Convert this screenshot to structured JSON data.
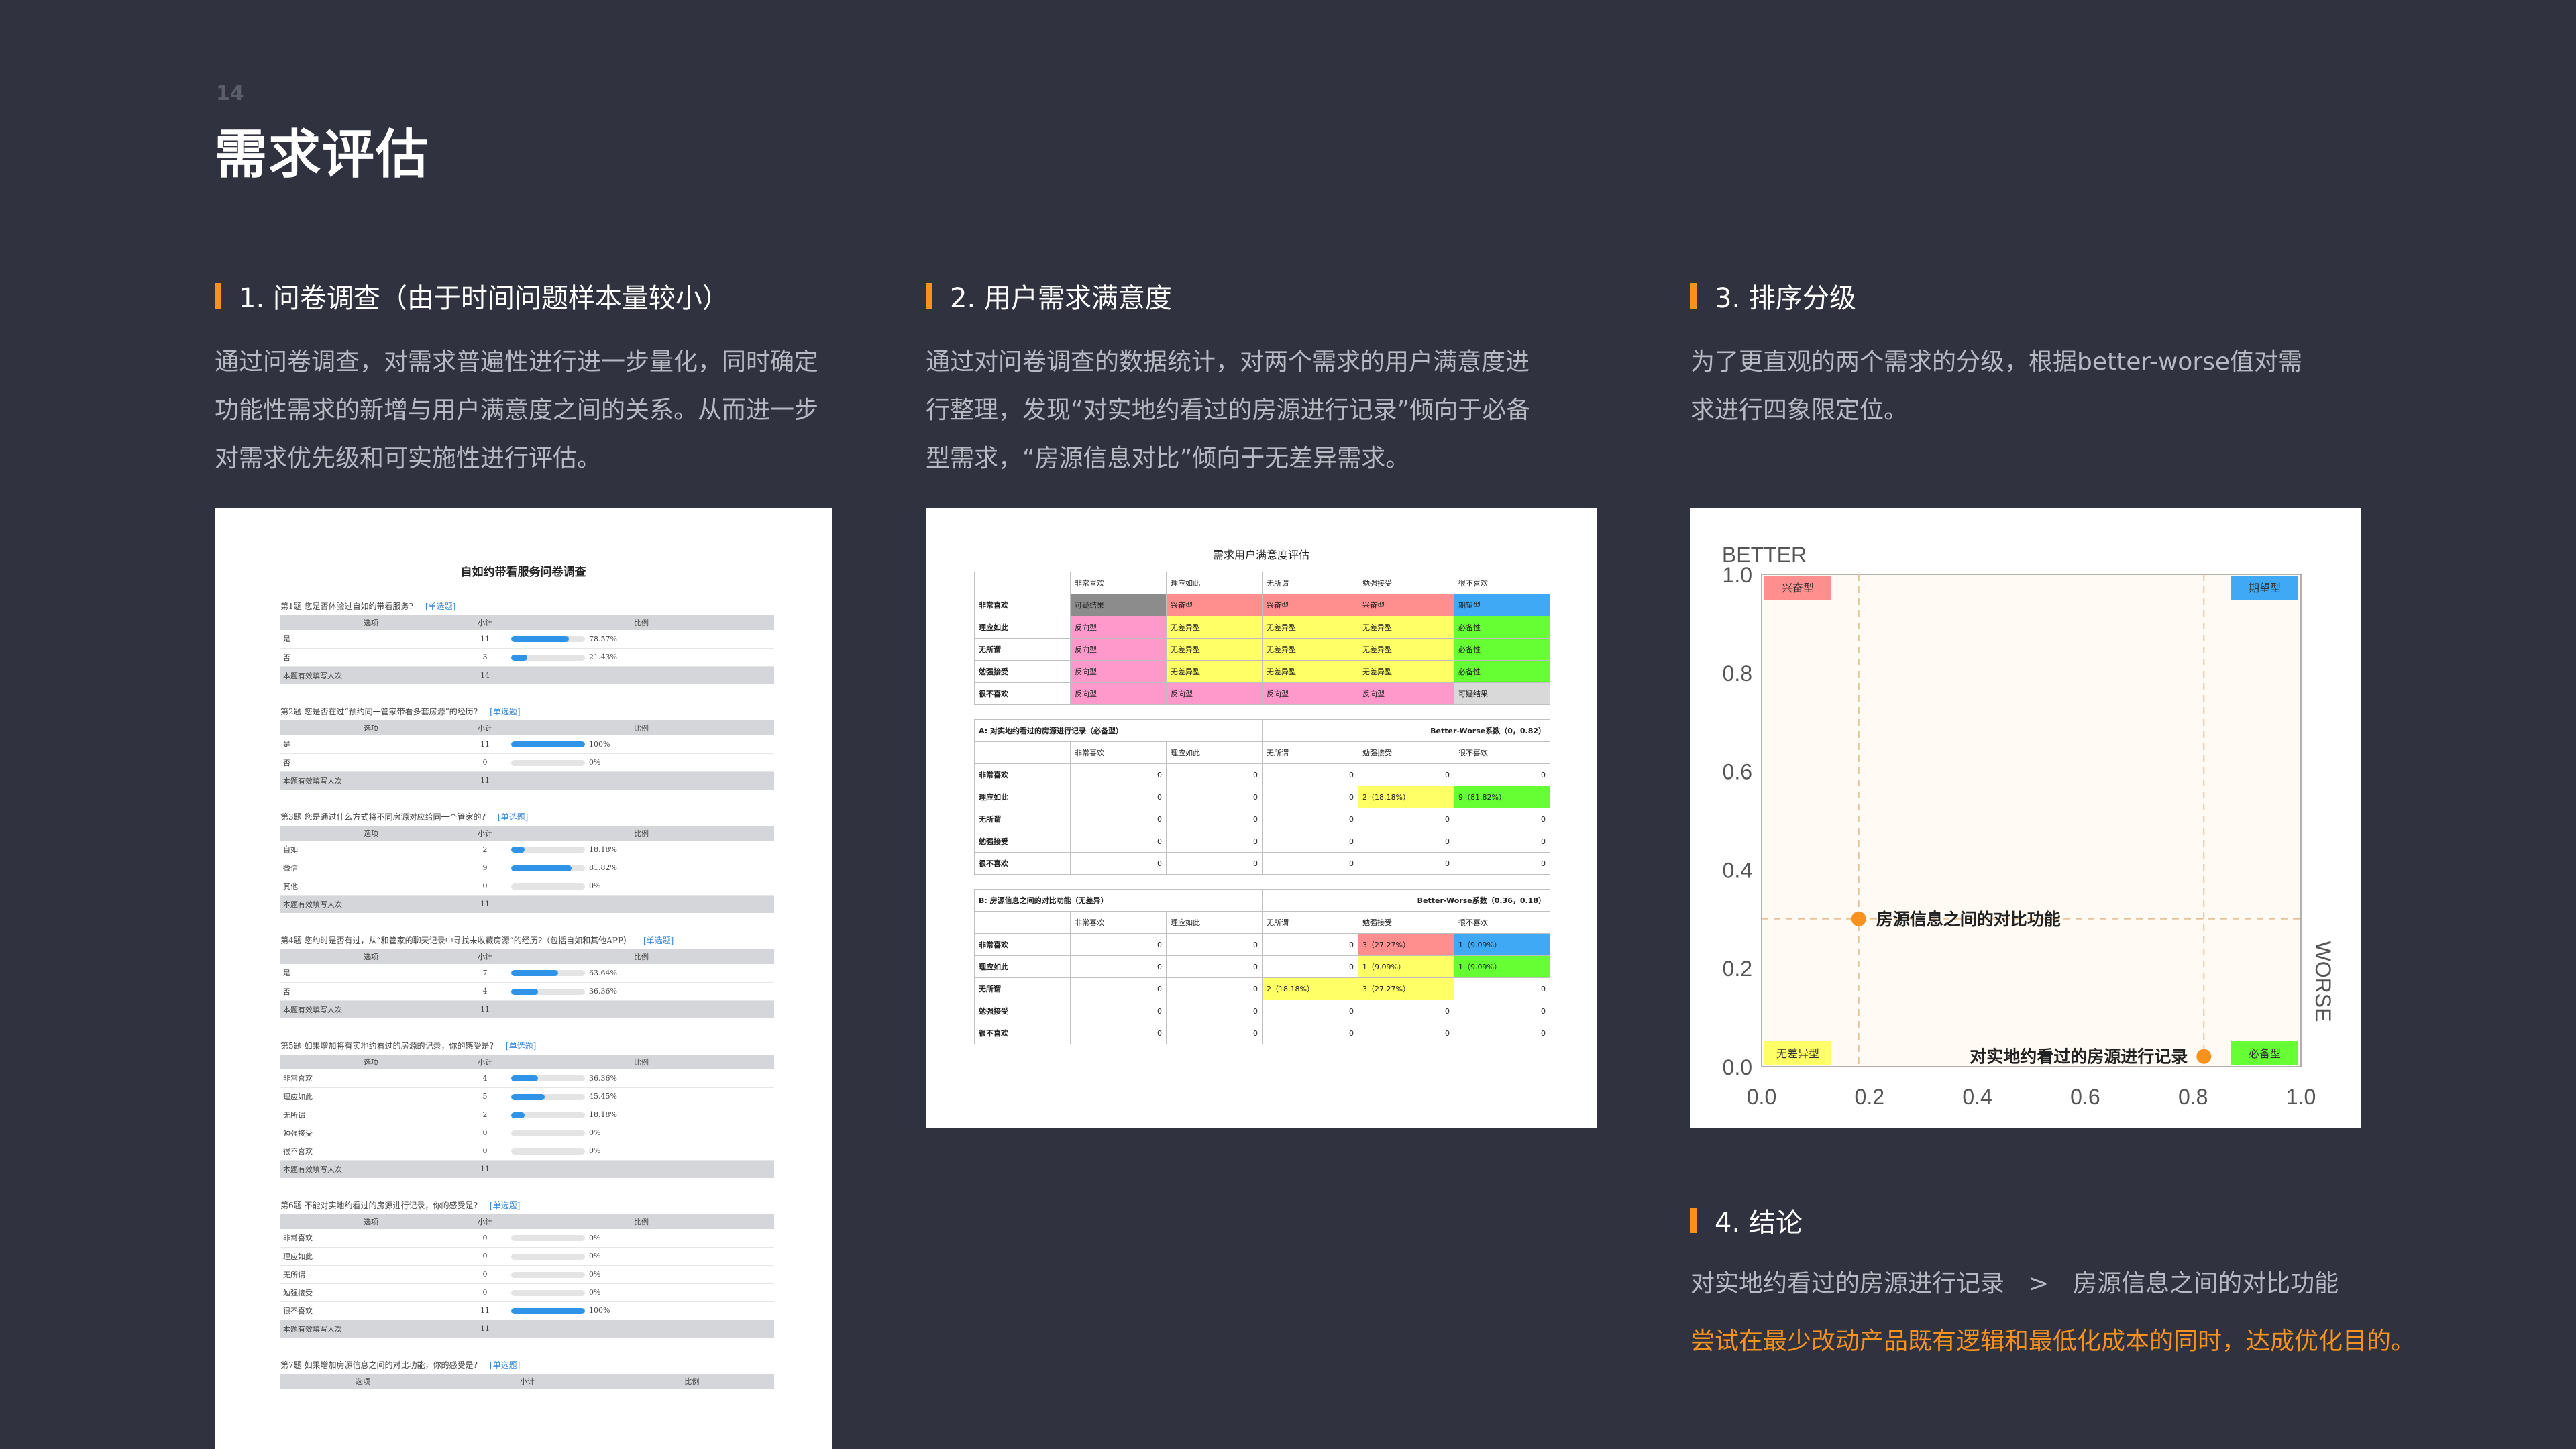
{
  "page": {
    "number": "14",
    "title": "需求评估"
  },
  "sections": [
    {
      "heading": "1. 问卷调查（由于时间问题样本量较小）",
      "lines": [
        "通过问卷调查，对需求普遍性进行进一步量化，同时确定",
        "功能性需求的新增与用户满意度之间的关系。从而进一步",
        "对需求优先级和可实施性进行评估。"
      ]
    },
    {
      "heading": "2. 用户需求满意度",
      "lines": [
        "通过对问卷调查的数据统计，对两个需求的用户满意度进",
        "行整理，发现“对实地约看过的房源进行记录”倾向于必备",
        "型需求，“房源信息对比”倾向于无差异需求。"
      ]
    },
    {
      "heading": "3. 排序分级",
      "lines": [
        "为了更直观的两个需求的分级，根据better-worse值对需",
        "求进行四象限定位。"
      ]
    },
    {
      "heading": "4. 结论",
      "lines": [
        "对实地约看过的房源进行记录　>　房源信息之间的对比功能",
        "尝试在最少改动产品既有逻辑和最低化成本的同时，达成优化目的。"
      ]
    }
  ],
  "survey": {
    "title": "自如约带看服务问卷调查",
    "header": [
      "选项",
      "小计",
      "比例"
    ],
    "total_label": "本题有效填写人次",
    "questions": [
      {
        "title": "第1题  您是否体验过自如约带看服务?",
        "tag": "[单选题]",
        "rows": [
          {
            "o": "是",
            "n": "11",
            "p": "78.57%",
            "f": 0.7857
          },
          {
            "o": "否",
            "n": "3",
            "p": "21.43%",
            "f": 0.2143
          }
        ],
        "total": "14"
      },
      {
        "title": "第2题  您是否在过“预约同一管家带看多套房源”的经历?",
        "tag": "[单选题]",
        "rows": [
          {
            "o": "是",
            "n": "11",
            "p": "100%",
            "f": 1
          },
          {
            "o": "否",
            "n": "0",
            "p": "0%",
            "f": 0
          }
        ],
        "total": "11"
      },
      {
        "title": "第3题  您是通过什么方式将不同房源对应给同一个管家的?",
        "tag": "[单选题]",
        "rows": [
          {
            "o": "自如",
            "n": "2",
            "p": "18.18%",
            "f": 0.1818
          },
          {
            "o": "微信",
            "n": "9",
            "p": "81.82%",
            "f": 0.8182
          },
          {
            "o": "其他",
            "n": "0",
            "p": "0%",
            "f": 0
          }
        ],
        "total": "11"
      },
      {
        "title": "第4题  您约时是否有过，从“和管家的聊天记录中寻找未收藏房源”的经历?（包括自如和其他APP）",
        "tag": "[单选题]",
        "rows": [
          {
            "o": "是",
            "n": "7",
            "p": "63.64%",
            "f": 0.6364
          },
          {
            "o": "否",
            "n": "4",
            "p": "36.36%",
            "f": 0.3636
          }
        ],
        "total": "11"
      },
      {
        "title": "第5题  如果增加将有实地约看过的房源的记录，你的感受是?",
        "tag": "[单选题]",
        "rows": [
          {
            "o": "非常喜欢",
            "n": "4",
            "p": "36.36%",
            "f": 0.3636
          },
          {
            "o": "理应如此",
            "n": "5",
            "p": "45.45%",
            "f": 0.4545
          },
          {
            "o": "无所谓",
            "n": "2",
            "p": "18.18%",
            "f": 0.1818
          },
          {
            "o": "勉强接受",
            "n": "0",
            "p": "0%",
            "f": 0
          },
          {
            "o": "很不喜欢",
            "n": "0",
            "p": "0%",
            "f": 0
          }
        ],
        "total": "11"
      },
      {
        "title": "第6题  不能对实地约看过的房源进行记录，你的感受是?",
        "tag": "[单选题]",
        "rows": [
          {
            "o": "非常喜欢",
            "n": "0",
            "p": "0%",
            "f": 0
          },
          {
            "o": "理应如此",
            "n": "0",
            "p": "0%",
            "f": 0
          },
          {
            "o": "无所谓",
            "n": "0",
            "p": "0%",
            "f": 0
          },
          {
            "o": "勉强接受",
            "n": "0",
            "p": "0%",
            "f": 0
          },
          {
            "o": "很不喜欢",
            "n": "11",
            "p": "100%",
            "f": 1
          }
        ],
        "total": "11"
      },
      {
        "title": "第7题  如果增加房源信息之间的对比功能，你的感受是?",
        "tag": "[单选题]",
        "rows": [],
        "total": ""
      }
    ]
  },
  "satisfaction": {
    "title": "需求用户满意度评估",
    "cols": [
      "非常喜欢",
      "理应如此",
      "无所谓",
      "勉强接受",
      "很不喜欢"
    ],
    "matrix_rows": [
      {
        "label": "非常喜欢",
        "cells": [
          {
            "t": "可疑结果",
            "c": "#8c8c8c"
          },
          {
            "t": "兴奋型",
            "c": "#ff8f8f"
          },
          {
            "t": "兴奋型",
            "c": "#ff8f8f"
          },
          {
            "t": "兴奋型",
            "c": "#ff8f8f"
          },
          {
            "t": "期望型",
            "c": "#3fa9f5"
          }
        ]
      },
      {
        "label": "理应如此",
        "cells": [
          {
            "t": "反向型",
            "c": "#ff99cc"
          },
          {
            "t": "无差异型",
            "c": "#ffff66"
          },
          {
            "t": "无差异型",
            "c": "#ffff66"
          },
          {
            "t": "无差异型",
            "c": "#ffff66"
          },
          {
            "t": "必备性",
            "c": "#66ff33"
          }
        ]
      },
      {
        "label": "无所谓",
        "cells": [
          {
            "t": "反向型",
            "c": "#ff99cc"
          },
          {
            "t": "无差异型",
            "c": "#ffff66"
          },
          {
            "t": "无差异型",
            "c": "#ffff66"
          },
          {
            "t": "无差异型",
            "c": "#ffff66"
          },
          {
            "t": "必备性",
            "c": "#66ff33"
          }
        ]
      },
      {
        "label": "勉强接受",
        "cells": [
          {
            "t": "反向型",
            "c": "#ff99cc"
          },
          {
            "t": "无差异型",
            "c": "#ffff66"
          },
          {
            "t": "无差异型",
            "c": "#ffff66"
          },
          {
            "t": "无差异型",
            "c": "#ffff66"
          },
          {
            "t": "必备性",
            "c": "#66ff33"
          }
        ]
      },
      {
        "label": "很不喜欢",
        "cells": [
          {
            "t": "反向型",
            "c": "#ff99cc"
          },
          {
            "t": "反向型",
            "c": "#ff99cc"
          },
          {
            "t": "反向型",
            "c": "#ff99cc"
          },
          {
            "t": "反向型",
            "c": "#ff99cc"
          },
          {
            "t": "可疑结果",
            "c": "#d9d9d9"
          }
        ]
      }
    ],
    "blocks": [
      {
        "name": "A: 对实地约看过的房源进行记录（必备型）",
        "coef": "Better-Worse系数（0，0.82）",
        "rows": [
          {
            "label": "非常喜欢",
            "cells": [
              {
                "t": "0"
              },
              {
                "t": "0"
              },
              {
                "t": "0"
              },
              {
                "t": "0"
              },
              {
                "t": "0"
              }
            ]
          },
          {
            "label": "理应如此",
            "cells": [
              {
                "t": "0"
              },
              {
                "t": "0"
              },
              {
                "t": "0"
              },
              {
                "t": "2（18.18%）",
                "c": "#ffff66",
                "l": 1
              },
              {
                "t": "9（81.82%）",
                "c": "#66ff33",
                "l": 1
              }
            ]
          },
          {
            "label": "无所谓",
            "cells": [
              {
                "t": "0"
              },
              {
                "t": "0"
              },
              {
                "t": "0"
              },
              {
                "t": "0"
              },
              {
                "t": "0"
              }
            ]
          },
          {
            "label": "勉强接受",
            "cells": [
              {
                "t": "0"
              },
              {
                "t": "0"
              },
              {
                "t": "0"
              },
              {
                "t": "0"
              },
              {
                "t": "0"
              }
            ]
          },
          {
            "label": "很不喜欢",
            "cells": [
              {
                "t": "0"
              },
              {
                "t": "0"
              },
              {
                "t": "0"
              },
              {
                "t": "0"
              },
              {
                "t": "0"
              }
            ]
          }
        ]
      },
      {
        "name": "B: 房源信息之间的对比功能（无差异）",
        "coef": "Better-Worse系数（0.36，0.18）",
        "rows": [
          {
            "label": "非常喜欢",
            "cells": [
              {
                "t": "0"
              },
              {
                "t": "0"
              },
              {
                "t": "0"
              },
              {
                "t": "3（27.27%）",
                "c": "#ff8f8f",
                "l": 1
              },
              {
                "t": "1（9.09%）",
                "c": "#3fa9f5",
                "l": 1
              }
            ]
          },
          {
            "label": "理应如此",
            "cells": [
              {
                "t": "0"
              },
              {
                "t": "0"
              },
              {
                "t": "0"
              },
              {
                "t": "1（9.09%）",
                "c": "#ffff66",
                "l": 1
              },
              {
                "t": "1（9.09%）",
                "c": "#66ff33",
                "l": 1
              }
            ]
          },
          {
            "label": "无所谓",
            "cells": [
              {
                "t": "0"
              },
              {
                "t": "0"
              },
              {
                "t": "2（18.18%）",
                "c": "#ffff66",
                "l": 1
              },
              {
                "t": "3（27.27%）",
                "c": "#ffff66",
                "l": 1
              },
              {
                "t": "0"
              }
            ]
          },
          {
            "label": "勉强接受",
            "cells": [
              {
                "t": "0"
              },
              {
                "t": "0"
              },
              {
                "t": "0"
              },
              {
                "t": "0"
              },
              {
                "t": "0"
              }
            ]
          },
          {
            "label": "很不喜欢",
            "cells": [
              {
                "t": "0"
              },
              {
                "t": "0"
              },
              {
                "t": "0"
              },
              {
                "t": "0"
              },
              {
                "t": "0"
              }
            ]
          }
        ]
      }
    ]
  },
  "chart_data": {
    "type": "scatter",
    "ylabel": "BETTER",
    "xlabel": "WORSE",
    "xlim": [
      0,
      1
    ],
    "ylim": [
      0,
      1
    ],
    "xticks": [
      "0.0",
      "0.2",
      "0.4",
      "0.6",
      "0.8",
      "1.0"
    ],
    "yticks": [
      "0.0",
      "0.2",
      "0.4",
      "0.6",
      "0.8",
      "1.0"
    ],
    "quadrants": [
      {
        "label": "兴奋型",
        "color": "#ff8f8f",
        "corner": "top-left"
      },
      {
        "label": "期望型",
        "color": "#3fa9f5",
        "corner": "top-right"
      },
      {
        "label": "无差异型",
        "color": "#ffff66",
        "corner": "bottom-left"
      },
      {
        "label": "必备型",
        "color": "#66ff33",
        "corner": "bottom-right"
      }
    ],
    "divider": {
      "x": 0.82,
      "y": 0.3
    },
    "divider2": {
      "x": 0.18
    },
    "points": [
      {
        "label": "房源信息之间的对比功能",
        "x": 0.18,
        "y": 0.3,
        "color": "#f7921e"
      },
      {
        "label": "对实地约看过的房源进行记录",
        "x": 0.82,
        "y": 0.01,
        "color": "#f7921e"
      }
    ]
  }
}
